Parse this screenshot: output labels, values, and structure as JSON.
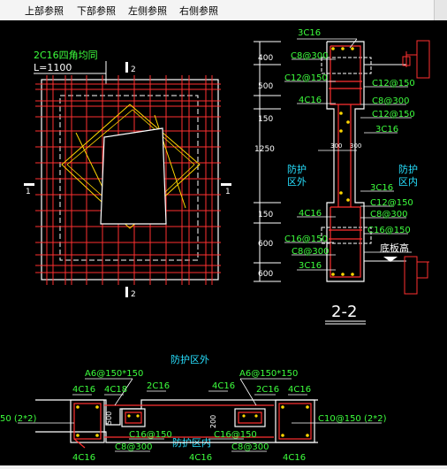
{
  "tabs": [
    "上部参照",
    "下部参照",
    "左侧参照",
    "右侧参照"
  ],
  "plan": {
    "note_line1": "2C16四角均同",
    "note_line2": "L=1100",
    "section_marks": [
      "1",
      "1",
      "2",
      "2"
    ]
  },
  "section": {
    "dims": [
      "400",
      "500",
      "150",
      "1250",
      "150",
      "600",
      "600"
    ],
    "labels": [
      "3C16",
      "C8@300",
      "C12@150",
      "C12@150",
      "4C16",
      "C8@300",
      "C12@150",
      "3C16",
      "防护",
      "区外",
      "防护",
      "区内",
      "300",
      "300",
      "3C16",
      "4C16",
      "C12@150",
      "C8@300",
      "C16@150",
      "C16@150",
      "C8@300",
      "底板高",
      "3C16"
    ],
    "title": "2-2"
  },
  "bottom": {
    "title_top": "防护区外",
    "title_bottom": "防护区内",
    "labels": [
      "A6@150*150",
      "A6@150*150",
      "4C16",
      "4C18",
      "2C16",
      "4C16",
      "2C16",
      "4C16",
      "C16@150",
      "C16@150",
      "C8@300",
      "C8@300",
      "4C16",
      "4C16",
      "4C16",
      "500",
      "200",
      "50 (2*2)",
      "C10@150 (2*2)"
    ]
  },
  "colors": {
    "background": "#000000",
    "rebar": "#ff3030",
    "outline": "#ffffff",
    "text_green": "#3dff3d",
    "text_cyan": "#27e0ff",
    "stirrup": "#ffd700",
    "marker": "#ff3030"
  }
}
